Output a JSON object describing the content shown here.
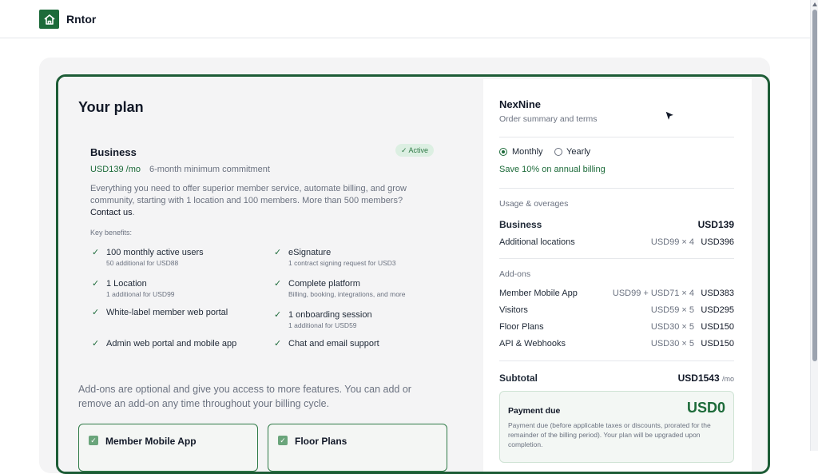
{
  "app": {
    "brand": "Rntor",
    "logo_icon": "house-icon",
    "accent": "#1d6b3a"
  },
  "plan": {
    "title": "Your plan",
    "name": "Business",
    "status": "✓ Active",
    "price": "USD139 /mo",
    "commitment": "6-month minimum commitment",
    "description": "Everything you need to offer superior member service, automate billing, and grow community, starting with 1 location and 100 members. More than 500 members?",
    "contact": "Contact us",
    "contact_suffix": ".",
    "key_benefits_label": "Key benefits:",
    "benefits": [
      {
        "title": "100 monthly active users",
        "sub": "50 additional for USD88"
      },
      {
        "title": "eSignature",
        "sub": "1 contract signing request for USD3"
      },
      {
        "title": "1 Location",
        "sub": "1 additional for USD99"
      },
      {
        "title": "Complete platform",
        "sub": "Billing, booking, integrations, and more"
      },
      {
        "title": "White-label member web portal",
        "sub": ""
      },
      {
        "title": "1 onboarding session",
        "sub": "1 additional for USD59"
      },
      {
        "title": "Admin web portal and mobile app",
        "sub": ""
      },
      {
        "title": "Chat and email support",
        "sub": ""
      }
    ],
    "addons_note": "Add-ons are optional and give you access to more features. You can add or remove an add-on any time throughout your billing cycle.",
    "addon_cards": [
      {
        "label": "Member Mobile App",
        "checked": true
      },
      {
        "label": "Floor Plans",
        "checked": true
      }
    ]
  },
  "summary": {
    "company": "NexNine",
    "subtitle": "Order summary and terms",
    "billing": {
      "monthly": "Monthly",
      "yearly": "Yearly",
      "selected": "Monthly",
      "save_note": "Save 10% on annual billing"
    },
    "usage_label": "Usage & overages",
    "usage_rows": [
      {
        "label": "Business",
        "calc": "",
        "value": "USD139"
      },
      {
        "label": "Additional locations",
        "calc": "USD99 × 4",
        "value": "USD396"
      }
    ],
    "addons_label": "Add-ons",
    "addon_rows": [
      {
        "label": "Member Mobile App",
        "calc": "USD99 + USD71 × 4",
        "value": "USD383"
      },
      {
        "label": "Visitors",
        "calc": "USD59 × 5",
        "value": "USD295"
      },
      {
        "label": "Floor Plans",
        "calc": "USD30 × 5",
        "value": "USD150"
      },
      {
        "label": "API & Webhooks",
        "calc": "USD30 × 5",
        "value": "USD150"
      }
    ],
    "subtotal_label": "Subtotal",
    "subtotal_value": "USD1543",
    "subtotal_unit": "/mo",
    "payment_due_label": "Payment due",
    "payment_due_value": "USD0",
    "payment_due_note": "Payment due (before applicable taxes or discounts, prorated for the remainder of the billing period). Your plan will be upgraded upon completion."
  }
}
